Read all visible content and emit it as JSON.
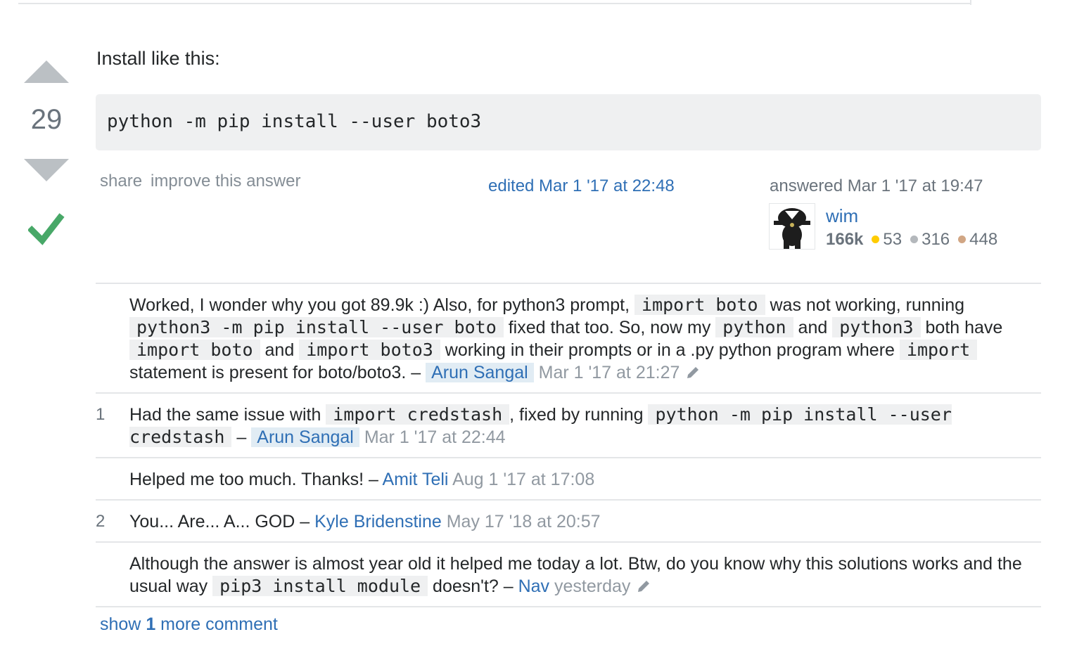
{
  "vote": {
    "count": "29",
    "up_icon": "arrow-up-icon",
    "down_icon": "arrow-down-icon",
    "accepted_icon": "checkmark-icon"
  },
  "answer": {
    "intro": "Install like this:",
    "code": "python -m pip install --user boto3"
  },
  "post_menu": {
    "share": "share",
    "improve": "improve this answer"
  },
  "edited": "edited Mar 1 '17 at 22:48",
  "answered": "answered Mar 1 '17 at 19:47",
  "user": {
    "name": "wim",
    "rep": "166k",
    "gold": "53",
    "silver": "316",
    "bronze": "448"
  },
  "comments": [
    {
      "score": "",
      "parts": [
        "Worked, I wonder why you got 89.9k :) Also, for python3 prompt, ",
        "import boto",
        " was not working, running ",
        "python3 -m pip install --user boto",
        " fixed that too. So, now my ",
        "python",
        " and ",
        "python3",
        " both have ",
        "import boto",
        " and ",
        "import boto3",
        " working in their prompts or in a .py python program where ",
        "import",
        " statement is present for boto/boto3. – "
      ],
      "user": "Arun Sangal",
      "date": "Mar 1 '17 at 21:27"
    },
    {
      "score": "1",
      "parts": [
        "Had the same issue with ",
        "import credstash",
        ", fixed by running ",
        "python -m pip install --user credstash",
        " – "
      ],
      "user": "Arun Sangal",
      "date": "Mar 1 '17 at 22:44"
    },
    {
      "score": "",
      "text": "Helped me too much. Thanks! – ",
      "user": "Amit Teli",
      "date": "Aug 1 '17 at 17:08"
    },
    {
      "score": "2",
      "text": "You... Are... A... GOD – ",
      "user": "Kyle Bridenstine",
      "date": "May 17 '18 at 20:57"
    },
    {
      "score": "",
      "parts": [
        "Although the answer is almost year old it helped me today a lot. Btw, do you know why this solutions works and the usual way ",
        "pip3 install module",
        " doesn't? – "
      ],
      "user": "Nav",
      "date": "yesterday"
    }
  ],
  "show_more": {
    "prefix": "show ",
    "count": "1",
    "suffix": " more comment"
  },
  "colors": {
    "link": "#2f6fb5",
    "accepted": "#48a868",
    "code_bg": "#eff0f1"
  }
}
